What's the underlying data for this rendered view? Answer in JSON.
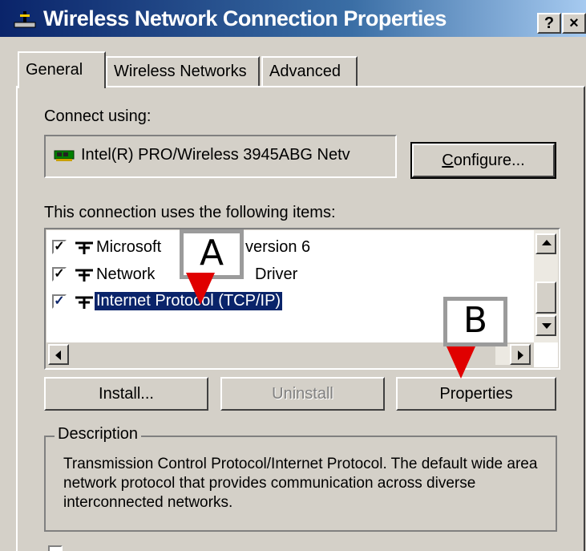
{
  "window": {
    "title": "Wireless Network Connection Properties",
    "help_label": "?",
    "close_label": "×"
  },
  "tabs": [
    {
      "label": "General",
      "active": true
    },
    {
      "label": "Wireless Networks",
      "active": false
    },
    {
      "label": "Advanced",
      "active": false
    }
  ],
  "general": {
    "connect_using_label": "Connect using:",
    "adapter_name": "Intel(R) PRO/Wireless 3945ABG Netv",
    "configure_label": "Configure...",
    "items_label": "This connection uses the following items:",
    "items": [
      {
        "label": "Microsoft",
        "label_tail": "version 6",
        "checked": true
      },
      {
        "label": "Network",
        "label_tail": "Driver",
        "checked": true
      },
      {
        "label": "Internet Protocol (TCP/IP)",
        "checked": true,
        "selected": true
      }
    ],
    "buttons": {
      "install": "Install...",
      "uninstall": "Uninstall",
      "properties": "Properties"
    },
    "description_title": "Description",
    "description_text": "Transmission Control Protocol/Internet Protocol. The default wide area network protocol that provides communication across diverse interconnected networks."
  },
  "callouts": [
    {
      "label": "A"
    },
    {
      "label": "B"
    }
  ],
  "colors": {
    "title_bar_start": "#0a246a",
    "title_bar_end": "#a6caf0",
    "selection": "#0a246a",
    "arrow": "#e00000",
    "face": "#d4d0c8"
  }
}
